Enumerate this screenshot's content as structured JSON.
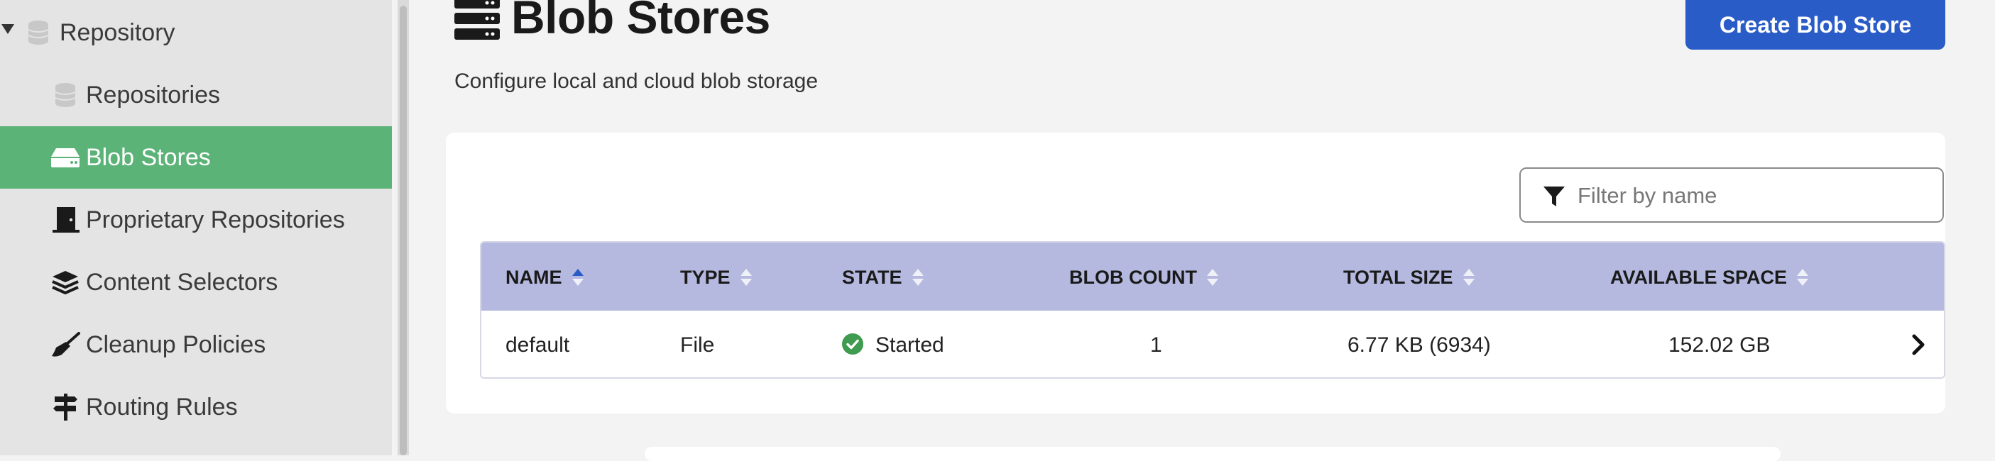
{
  "sidebar": {
    "parent": {
      "label": "Repository"
    },
    "items": [
      {
        "label": "Repositories"
      },
      {
        "label": "Blob Stores"
      },
      {
        "label": "Proprietary Repositories"
      },
      {
        "label": "Content Selectors"
      },
      {
        "label": "Cleanup Policies"
      },
      {
        "label": "Routing Rules"
      }
    ],
    "active_color": "#5cb378"
  },
  "header": {
    "title": "Blob Stores",
    "subtitle": "Configure local and cloud blob storage",
    "create_button": "Create Blob Store"
  },
  "filter": {
    "placeholder": "Filter by name"
  },
  "table": {
    "columns": [
      "NAME",
      "TYPE",
      "STATE",
      "BLOB COUNT",
      "TOTAL SIZE",
      "AVAILABLE SPACE"
    ],
    "rows": [
      {
        "name": "default",
        "type": "File",
        "state": "Started",
        "blob_count": "1",
        "total_size": "6.77 KB (6934)",
        "available_space": "152.02 GB"
      }
    ],
    "header_color": "#b5b9df"
  },
  "colors": {
    "primary": "#2a5cc7",
    "success": "#3f9b4f"
  }
}
